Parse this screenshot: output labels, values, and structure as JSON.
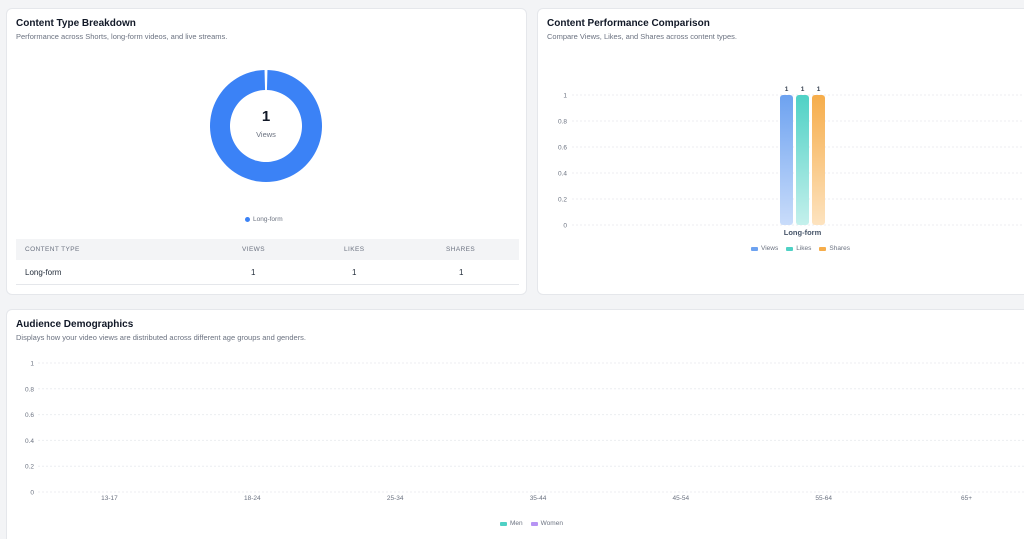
{
  "content_breakdown": {
    "title": "Content Type Breakdown",
    "subtitle": "Performance across Shorts, long-form videos, and live streams.",
    "center_value": "1",
    "center_label": "Views",
    "legend": [
      {
        "label": "Long-form",
        "color": "#3b82f6"
      }
    ],
    "table": {
      "headers": [
        "CONTENT TYPE",
        "VIEWS",
        "LIKES",
        "SHARES"
      ],
      "rows": [
        [
          "Long-form",
          "1",
          "1",
          "1"
        ]
      ]
    }
  },
  "performance": {
    "title": "Content Performance Comparison",
    "subtitle": "Compare Views, Likes, and Shares across content types.",
    "legend": [
      {
        "label": "Views",
        "color": "#6da2f0"
      },
      {
        "label": "Likes",
        "color": "#4fd1c5"
      },
      {
        "label": "Shares",
        "color": "#f6ad4b"
      }
    ]
  },
  "demographics": {
    "title": "Audience Demographics",
    "subtitle": "Displays how your video views are distributed across different age groups and genders.",
    "legend": [
      {
        "label": "Men",
        "color": "#4fd1c5"
      },
      {
        "label": "Women",
        "color": "#b794f4"
      }
    ]
  },
  "chart_data": [
    {
      "type": "pie",
      "categories": [
        "Long-form"
      ],
      "values": [
        1
      ],
      "colors": [
        "#3b82f6"
      ]
    },
    {
      "type": "bar",
      "categories": [
        "Long-form"
      ],
      "series": [
        {
          "name": "Views",
          "values": [
            1
          ],
          "color": "#6da2f0"
        },
        {
          "name": "Likes",
          "values": [
            1
          ],
          "color": "#4fd1c5"
        },
        {
          "name": "Shares",
          "values": [
            1
          ],
          "color": "#f6ad4b"
        }
      ],
      "ylim": [
        0,
        1
      ],
      "yticks": [
        "1",
        "0.8",
        "0.6",
        "0.4",
        "0.2",
        "0"
      ],
      "grid": true,
      "legend": "bottom"
    },
    {
      "type": "bar",
      "categories": [
        "13-17",
        "18-24",
        "25-34",
        "35-44",
        "45-54",
        "55-64",
        "65+"
      ],
      "series": [
        {
          "name": "Men",
          "values": [
            0,
            0,
            0,
            0,
            0,
            0,
            0
          ],
          "color": "#4fd1c5"
        },
        {
          "name": "Women",
          "values": [
            0,
            0,
            0,
            0,
            0,
            0,
            0
          ],
          "color": "#b794f4"
        }
      ],
      "ylim": [
        0,
        1
      ],
      "yticks": [
        "1",
        "0.8",
        "0.6",
        "0.4",
        "0.2",
        "0"
      ],
      "grid": true,
      "legend": "bottom"
    }
  ]
}
